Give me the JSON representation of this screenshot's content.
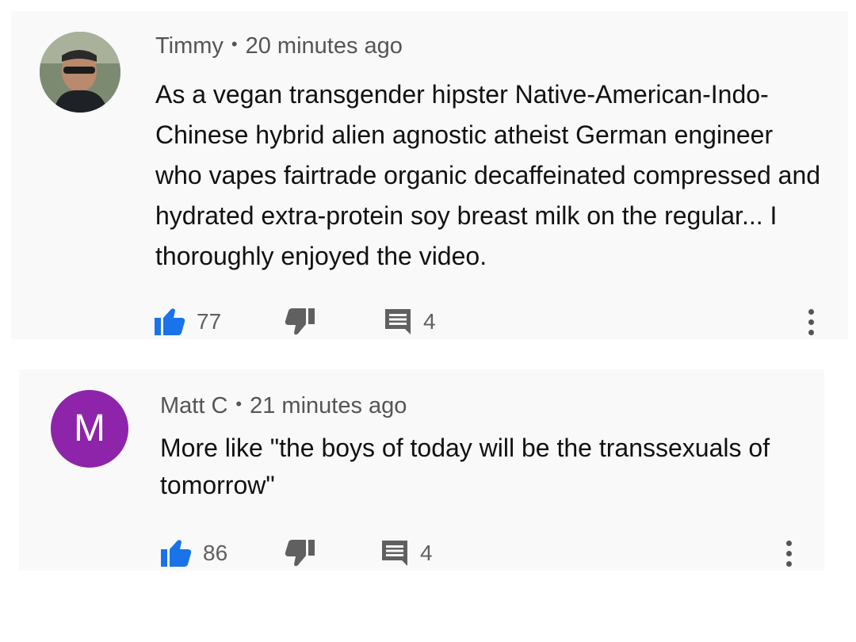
{
  "comments": [
    {
      "author": "Timmy",
      "separator": "•",
      "time": "20 minutes ago",
      "text": "As a vegan transgender hipster Native-American-Indo-Chinese hybrid alien agnostic atheist German engineer who vapes fairtrade organic decaffeinated compressed and hydrated extra-protein soy breast milk on the regular... I thoroughly enjoyed the video.",
      "avatar": "profile-photo",
      "likes": "77",
      "replies": "4",
      "like_icon": "thumbs-up-icon",
      "dislike_icon": "thumbs-down-icon",
      "reply_icon": "comment-icon",
      "more_icon": "more-vert-icon"
    },
    {
      "author": "Matt C",
      "separator": "•",
      "time": "21 minutes ago",
      "text": "More like \"the boys of today will be the transsexuals of tomorrow\"",
      "avatar_letter": "M",
      "avatar_color": "#8e24aa",
      "likes": "86",
      "replies": "4",
      "like_icon": "thumbs-up-icon",
      "dislike_icon": "thumbs-down-icon",
      "reply_icon": "comment-icon",
      "more_icon": "more-vert-icon"
    }
  ],
  "colors": {
    "like_active": "#1a73e8",
    "icon_gray": "#606060",
    "card_bg": "#f9f9f9"
  }
}
